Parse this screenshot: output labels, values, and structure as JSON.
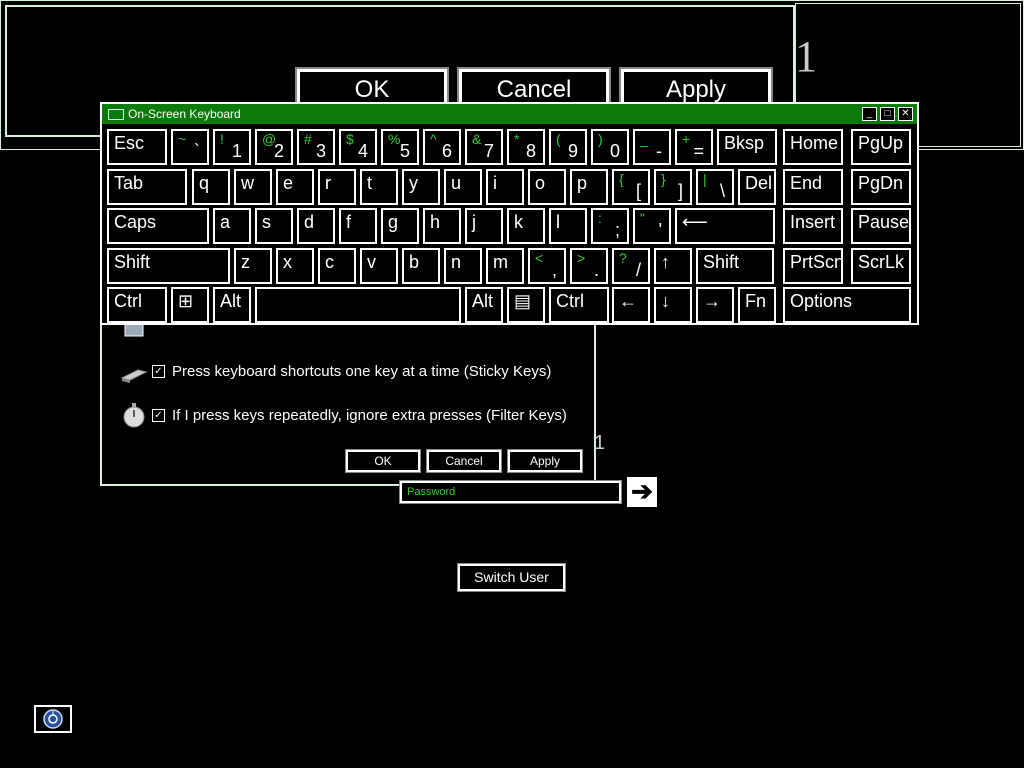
{
  "big_dialog": {
    "ok": "OK",
    "cancel": "Cancel",
    "apply": "Apply",
    "partial_char": "1"
  },
  "ease_dialog": {
    "options": [
      {
        "label": "Press keyboard shortcuts one key at a time (Sticky Keys)",
        "checked": true,
        "icon": "sticky-keys-icon"
      },
      {
        "label": "If I press keys repeatedly, ignore extra presses (Filter Keys)",
        "checked": true,
        "icon": "stopwatch-icon"
      }
    ],
    "ok": "OK",
    "cancel": "Cancel",
    "apply": "Apply",
    "partial_char": "1"
  },
  "login": {
    "password_placeholder": "Password",
    "switch_user": "Switch User",
    "go_icon": "arrow-right-icon",
    "ease_icon": "ease-of-access-icon"
  },
  "osk": {
    "title": "On-Screen Keyboard",
    "row1": [
      {
        "main": "Esc"
      },
      {
        "up": "~",
        "low": "`"
      },
      {
        "up": "!",
        "low": "1"
      },
      {
        "up": "@",
        "low": "2"
      },
      {
        "up": "#",
        "low": "3"
      },
      {
        "up": "$",
        "low": "4"
      },
      {
        "up": "%",
        "low": "5"
      },
      {
        "up": "^",
        "low": "6"
      },
      {
        "up": "&",
        "low": "7"
      },
      {
        "up": "*",
        "low": "8"
      },
      {
        "up": "(",
        "low": "9"
      },
      {
        "up": ")",
        "low": "0"
      },
      {
        "up": "_",
        "low": "-"
      },
      {
        "up": "+",
        "low": "="
      },
      {
        "main": "Bksp"
      },
      {
        "main": "Home"
      },
      {
        "main": "PgUp"
      }
    ],
    "row2": [
      {
        "main": "Tab"
      },
      {
        "main": "q"
      },
      {
        "main": "w"
      },
      {
        "main": "e"
      },
      {
        "main": "r"
      },
      {
        "main": "t"
      },
      {
        "main": "y"
      },
      {
        "main": "u"
      },
      {
        "main": "i"
      },
      {
        "main": "o"
      },
      {
        "main": "p"
      },
      {
        "up": "{",
        "low": "["
      },
      {
        "up": "}",
        "low": "]"
      },
      {
        "up": "|",
        "low": "\\"
      },
      {
        "main": "Del"
      },
      {
        "main": "End"
      },
      {
        "main": "PgDn"
      }
    ],
    "row3": [
      {
        "main": "Caps"
      },
      {
        "main": "a"
      },
      {
        "main": "s"
      },
      {
        "main": "d"
      },
      {
        "main": "f"
      },
      {
        "main": "g"
      },
      {
        "main": "h"
      },
      {
        "main": "j"
      },
      {
        "main": "k"
      },
      {
        "main": "l"
      },
      {
        "up": ":",
        "low": ";"
      },
      {
        "up": "\"",
        "low": "'"
      },
      {
        "main": "⟵"
      },
      {
        "main": "Insert"
      },
      {
        "main": "Pause"
      }
    ],
    "row4": [
      {
        "main": "Shift"
      },
      {
        "main": "z"
      },
      {
        "main": "x"
      },
      {
        "main": "c"
      },
      {
        "main": "v"
      },
      {
        "main": "b"
      },
      {
        "main": "n"
      },
      {
        "main": "m"
      },
      {
        "up": "<",
        "low": ","
      },
      {
        "up": ">",
        "low": "."
      },
      {
        "up": "?",
        "low": "/"
      },
      {
        "main": "↑"
      },
      {
        "main": "Shift"
      },
      {
        "main": "PrtScn"
      },
      {
        "main": "ScrLk"
      }
    ],
    "row5": [
      {
        "main": "Ctrl"
      },
      {
        "main": "⊞"
      },
      {
        "main": "Alt"
      },
      {
        "main": ""
      },
      {
        "main": "Alt"
      },
      {
        "main": "▤"
      },
      {
        "main": "Ctrl"
      },
      {
        "main": "←"
      },
      {
        "main": "↓"
      },
      {
        "main": "→"
      },
      {
        "main": "Fn"
      },
      {
        "main": "Options"
      }
    ]
  }
}
